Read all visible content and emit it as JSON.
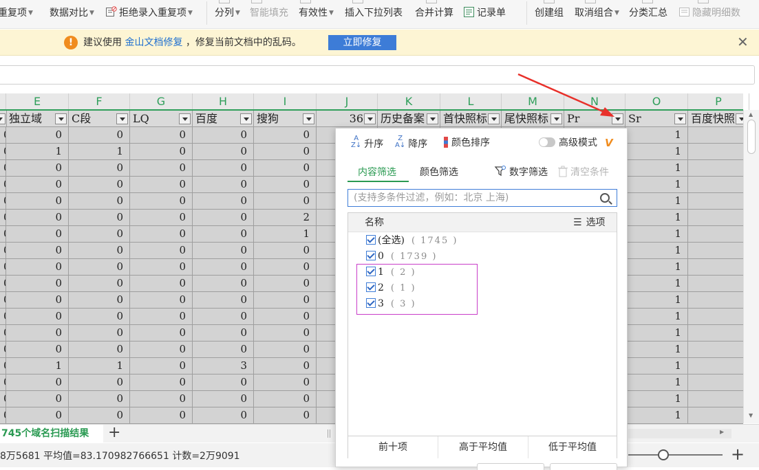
{
  "ribbon": {
    "items": [
      {
        "label": "重复项",
        "has_arrow": true,
        "disabled": false
      },
      {
        "label": "数据对比",
        "has_arrow": true,
        "disabled": false
      },
      {
        "label": "拒绝录入重复项",
        "has_arrow": true,
        "disabled": false
      },
      {
        "label": "分列",
        "has_arrow": true,
        "disabled": false
      },
      {
        "label": "智能填充",
        "has_arrow": false,
        "disabled": true
      },
      {
        "label": "有效性",
        "has_arrow": true,
        "disabled": false
      },
      {
        "label": "插入下拉列表",
        "has_arrow": false,
        "disabled": false
      },
      {
        "label": "合并计算",
        "has_arrow": false,
        "disabled": false
      },
      {
        "label": "记录单",
        "has_arrow": false,
        "disabled": false
      },
      {
        "label": "创建组",
        "has_arrow": false,
        "disabled": false
      },
      {
        "label": "取消组合",
        "has_arrow": true,
        "disabled": false
      },
      {
        "label": "分类汇总",
        "has_arrow": false,
        "disabled": false
      },
      {
        "label": "隐藏明细数",
        "has_arrow": false,
        "disabled": true
      }
    ]
  },
  "notification": {
    "prefix": "建议使用",
    "link": "金山文档修复",
    "suffix": "，修复当前文档中的乱码。",
    "button": "立即修复",
    "close": "✕"
  },
  "sheet": {
    "columns": [
      "E",
      "F",
      "G",
      "H",
      "I",
      "J",
      "K",
      "L",
      "M",
      "N",
      "O",
      "P"
    ],
    "header_row": {
      "partial": "独立域",
      "cells": [
        "C段",
        "LQ",
        "百度",
        "搜狗",
        "36",
        "历史备案",
        "首快照标",
        "尾快照标",
        "Pr",
        "Sr",
        "百度快照"
      ]
    },
    "rows": [
      [
        "0",
        "0",
        "0",
        "0",
        "0",
        "0",
        "1"
      ],
      [
        "0",
        "1",
        "1",
        "0",
        "0",
        "0",
        "1"
      ],
      [
        "0",
        "0",
        "0",
        "0",
        "0",
        "0",
        "1"
      ],
      [
        "0",
        "0",
        "0",
        "0",
        "0",
        "0",
        "1"
      ],
      [
        "0",
        "0",
        "0",
        "0",
        "0",
        "0",
        "1"
      ],
      [
        "0",
        "0",
        "0",
        "0",
        "0",
        "2",
        "1"
      ],
      [
        "0",
        "0",
        "0",
        "0",
        "0",
        "1",
        "1"
      ],
      [
        "0",
        "0",
        "0",
        "0",
        "0",
        "0",
        "1"
      ],
      [
        "0",
        "0",
        "0",
        "0",
        "0",
        "0",
        "1"
      ],
      [
        "0",
        "0",
        "0",
        "0",
        "0",
        "0",
        "1"
      ],
      [
        "0",
        "0",
        "0",
        "0",
        "0",
        "0",
        "1"
      ],
      [
        "0",
        "0",
        "0",
        "0",
        "0",
        "0",
        "1"
      ],
      [
        "0",
        "0",
        "0",
        "0",
        "0",
        "0",
        "1"
      ],
      [
        "0",
        "0",
        "0",
        "0",
        "0",
        "0",
        "1"
      ],
      [
        "0",
        "1",
        "1",
        "0",
        "3",
        "0",
        "1"
      ],
      [
        "0",
        "0",
        "0",
        "0",
        "0",
        "0",
        "1"
      ],
      [
        "0",
        "0",
        "0",
        "0",
        "0",
        "0",
        "1"
      ],
      [
        "0",
        "0",
        "0",
        "0",
        "0",
        "0",
        "1"
      ]
    ]
  },
  "tabs": {
    "active": "745个域名扫描结果",
    "add": "+"
  },
  "status": {
    "text": "8万5681  平均值=83.170982766651  计数=2万9091",
    "zoom_plus": "+"
  },
  "filter_panel": {
    "sort_asc": "升序",
    "sort_desc": "降序",
    "color_sort": "颜色排序",
    "advanced": "高级模式",
    "vip": "V",
    "tab_content": "内容筛选",
    "tab_color": "颜色筛选",
    "number_filter": "数字筛选",
    "clear": "清空条件",
    "search_placeholder": "(支持多条件过滤，例如：北京 上海)",
    "list_header": "名称",
    "options": "选项",
    "items": [
      {
        "label": "(全选)",
        "count": "( 1745 )",
        "checked": true
      },
      {
        "label": "0",
        "count": "( 1739 )",
        "checked": true
      },
      {
        "label": "1",
        "count": "( 2 )",
        "checked": true
      },
      {
        "label": "2",
        "count": "( 1 )",
        "checked": true
      },
      {
        "label": "3",
        "count": "( 3 )",
        "checked": true
      }
    ],
    "quick": [
      "前十项",
      "高于平均值",
      "低于平均值"
    ]
  },
  "colors": {
    "accent_green": "#2a9a52",
    "accent_blue": "#3d7cd7",
    "annotation_red": "#e8302a",
    "highlight_magenta": "#c83cc8"
  }
}
